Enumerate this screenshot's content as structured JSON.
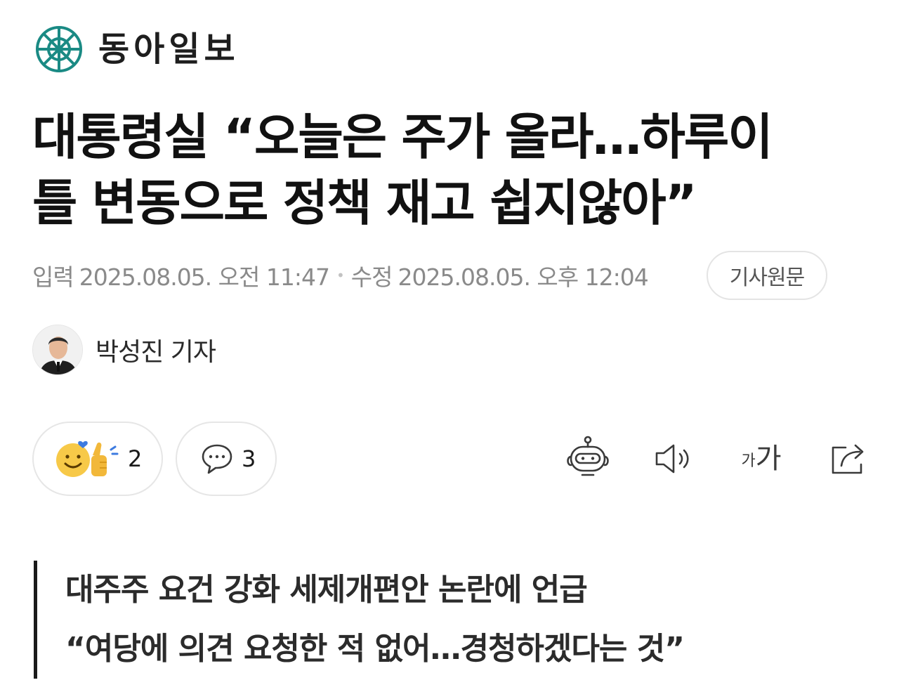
{
  "masthead": {
    "name": "동아일보",
    "brand_color": "#1a8a84"
  },
  "article": {
    "headline_line1": "대통령실 “오늘은 주가 올라…하루이",
    "headline_line2": "틀 변동으로 정책 재고 쉽지않아”",
    "published_label": "입력",
    "published_at": "2025.08.05. 오전 11:47",
    "modified_label": "수정",
    "modified_at": "2025.08.05. 오후 12:04",
    "source_button": "기사원문",
    "reporter": "박성진 기자",
    "subheadline_1": "대주주 요건 강화 세제개편안 논란에 언급",
    "subheadline_2": "“여당에 의견 요청한 적 없어…경청하겠다는 것”"
  },
  "actions": {
    "reaction_count": "2",
    "comment_count": "3",
    "font_size_label_small": "가",
    "font_size_label_large": "가",
    "icons": [
      "reaction-icon",
      "comment-icon",
      "ai-summary-icon",
      "audio-icon",
      "font-size-icon",
      "share-icon"
    ]
  },
  "colors": {
    "text": "#111111",
    "meta": "#8a8a8a",
    "reaction_face": "#f7c948",
    "reaction_heart": "#3d7be0"
  }
}
